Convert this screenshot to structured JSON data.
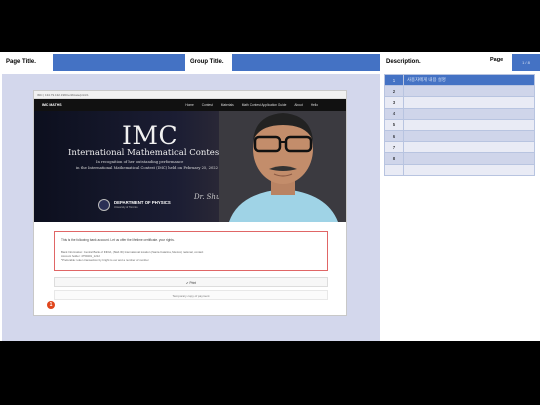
{
  "header": {
    "page_title_label": "Page Title.",
    "group_title_label": "Group Title.",
    "description_label": "Description.",
    "page_label": "Page",
    "page_number": "1 / 8"
  },
  "browser": {
    "address": "IMC | 134.79.132.198/certificate/print/1"
  },
  "site": {
    "logo": "IMC MATHS",
    "nav": [
      "Home",
      "Contest",
      "Materials",
      "Math Contest Application Guide",
      "About",
      "Hello"
    ]
  },
  "banner": {
    "title": "IMC",
    "subtitle": "International Mathematical Contest",
    "line1": "In recognition of her outstanding performance",
    "line2": "in the International Mathematical Contest (IMC) held on February 25, 2022",
    "dept": "DEPARTMENT OF PHYSICS",
    "dept_sub": "University of Toronto",
    "signature": "Dr. Shubhang Paranjpe"
  },
  "notice": {
    "title": "This is the following bank account. Let us offer the lifetime certificate. your rights.",
    "line1": "Bank Information: Central Bank of INDIA, (Slab ID) International location (Santa Catarina, Mexico) national, contact",
    "line2": "Account holder: 4750401_1212",
    "line3": "*Preferable: token transaction by bright to our and a number of number"
  },
  "marker": "1",
  "print_button": "✔ Print",
  "temp_copy": "Temporary copy of payment",
  "description_table": {
    "rows": [
      {
        "num": "1",
        "text": "사용자에게 내용 설명"
      },
      {
        "num": "2",
        "text": ""
      },
      {
        "num": "3",
        "text": ""
      },
      {
        "num": "4",
        "text": ""
      },
      {
        "num": "5",
        "text": ""
      },
      {
        "num": "6",
        "text": ""
      },
      {
        "num": "7",
        "text": ""
      },
      {
        "num": "8",
        "text": ""
      },
      {
        "num": "",
        "text": ""
      }
    ]
  },
  "colors": {
    "header_field": "#4472c4",
    "work_area": "#d3d7ec",
    "marker": "#e0461d",
    "notice_border": "#e06666"
  }
}
